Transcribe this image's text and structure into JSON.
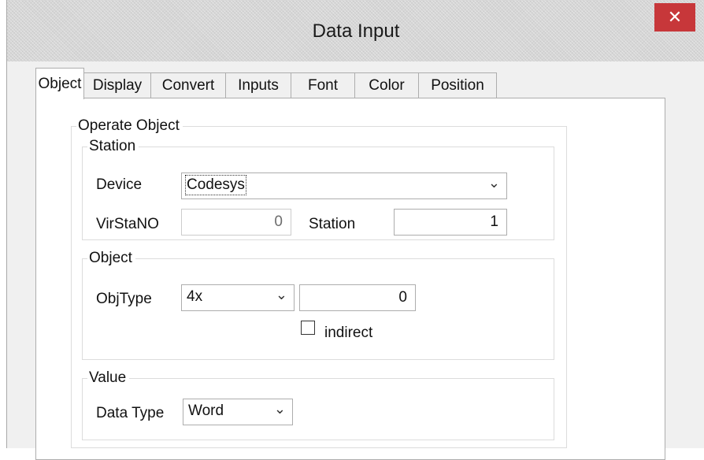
{
  "window": {
    "title": "Data Input",
    "close_symbol": "✕"
  },
  "tabs": [
    "Object",
    "Display",
    "Convert",
    "Inputs",
    "Font",
    "Color",
    "Position"
  ],
  "operate_object": {
    "label": "Operate Object",
    "station": {
      "label": "Station",
      "device_label": "Device",
      "device_value": "Codesys",
      "virstano_label": "VirStaNO",
      "virstano_value": "0",
      "station_label": "Station",
      "station_value": "1"
    },
    "object": {
      "label": "Object",
      "objtype_label": "ObjType",
      "objtype_value": "4x",
      "address_value": "0",
      "indirect_label": "indirect",
      "indirect_checked": false
    },
    "value": {
      "label": "Value",
      "datatype_label": "Data Type",
      "datatype_value": "Word"
    }
  },
  "icons": {
    "close": "close-icon",
    "dropdown": "chevron-down-icon"
  },
  "colors": {
    "close_button": "#c7373a",
    "dialog_bg": "#f0f0f0",
    "panel_bg": "#ffffff"
  }
}
